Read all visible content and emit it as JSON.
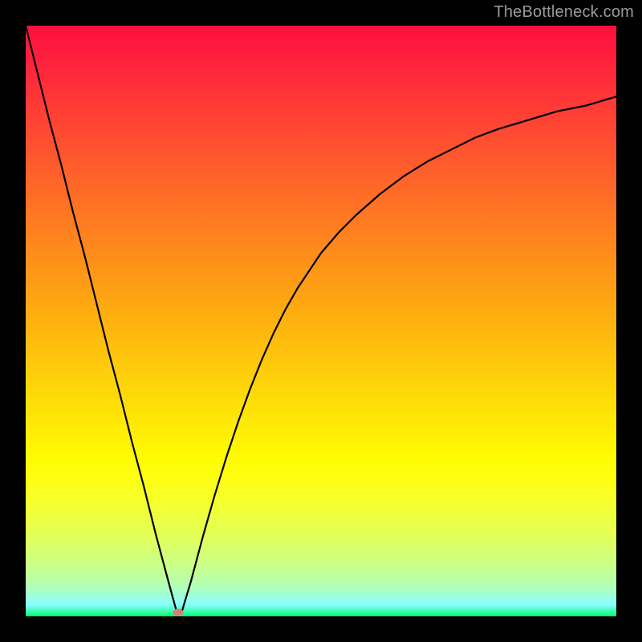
{
  "watermark": {
    "text": "TheBottleneck.com"
  },
  "chart_data": {
    "type": "line",
    "title": "",
    "xlabel": "",
    "ylabel": "",
    "xlim": [
      0,
      100
    ],
    "ylim": [
      0,
      100
    ],
    "grid": false,
    "legend": false,
    "gradient_stops": [
      {
        "pos": 0,
        "color": "#fe103f"
      },
      {
        "pos": 4,
        "color": "#fe1b3e"
      },
      {
        "pos": 13,
        "color": "#ff3936"
      },
      {
        "pos": 23,
        "color": "#ff5a2d"
      },
      {
        "pos": 48,
        "color": "#feab10"
      },
      {
        "pos": 58,
        "color": "#fecb0b"
      },
      {
        "pos": 68,
        "color": "#feeb05"
      },
      {
        "pos": 73,
        "color": "#fffb02"
      },
      {
        "pos": 76,
        "color": "#feff0e"
      },
      {
        "pos": 80,
        "color": "#f7ff28"
      },
      {
        "pos": 86,
        "color": "#e4ff54"
      },
      {
        "pos": 92,
        "color": "#c6ff8f"
      },
      {
        "pos": 95,
        "color": "#b0ffb8"
      },
      {
        "pos": 98,
        "color": "#8affff"
      },
      {
        "pos": 100,
        "color": "#00ff6e"
      }
    ],
    "series": [
      {
        "name": "bottleneck-curve",
        "x": [
          0.0,
          2.0,
          4.0,
          6.0,
          8.0,
          10.0,
          12.0,
          14.0,
          16.0,
          18.0,
          20.0,
          22.0,
          24.0,
          25.5,
          26.5,
          28.0,
          30.0,
          32.0,
          34.0,
          36.0,
          38.0,
          40.0,
          42.0,
          44.0,
          46.0,
          48.0,
          50.0,
          53.0,
          56.0,
          60.0,
          64.0,
          68.0,
          72.0,
          76.0,
          80.0,
          85.0,
          90.0,
          95.0,
          100.0
        ],
        "y": [
          100.0,
          92.0,
          84.0,
          76.5,
          68.5,
          61.0,
          53.0,
          45.0,
          37.5,
          29.5,
          22.0,
          14.0,
          6.5,
          1.0,
          1.0,
          6.0,
          13.5,
          20.5,
          27.0,
          33.0,
          38.5,
          43.5,
          48.0,
          52.0,
          55.5,
          58.5,
          61.5,
          65.0,
          68.0,
          71.5,
          74.5,
          77.0,
          79.0,
          81.0,
          82.5,
          84.0,
          85.5,
          86.5,
          88.0
        ]
      }
    ],
    "marker": {
      "x": 25.8,
      "y": 0.7,
      "color": "#cf8173"
    }
  }
}
